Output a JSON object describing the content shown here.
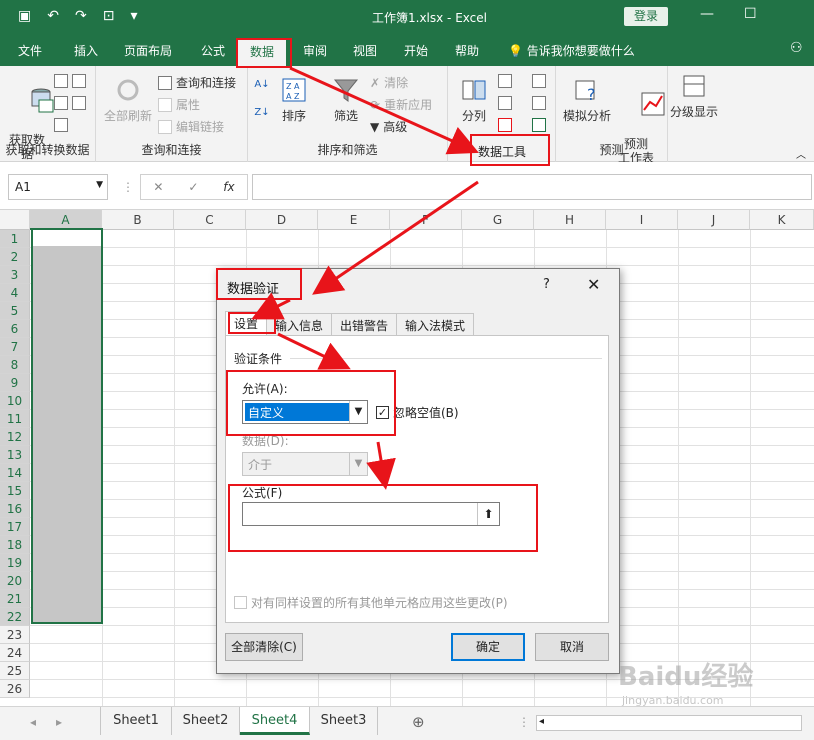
{
  "window": {
    "title": "工作簿1.xlsx  -  Excel",
    "login": "登录",
    "min": "—",
    "restore": "☐"
  },
  "menu": {
    "tabs": [
      "文件",
      "插入",
      "页面布局",
      "公式",
      "数据",
      "审阅",
      "视图",
      "开始",
      "帮助"
    ],
    "tellme": "告诉我你想要做什么"
  },
  "ribbon": {
    "get_data": "获取数\n据",
    "group1_label": "获取和转换数据",
    "refresh_all": "全部刷新",
    "queries": "查询和连接",
    "properties": "属性",
    "edit_links": "编辑链接",
    "group2_label": "查询和连接",
    "sort": "排序",
    "filter": "筛选",
    "clear": "清除",
    "reapply": "重新应用",
    "advanced": "高级",
    "group3_label": "排序和筛选",
    "text_to_columns": "分列",
    "group4_label": "数据工具",
    "what_if": "模拟分析",
    "forecast": "预测\n工作表",
    "group5_label": "预测",
    "outline": "分级显示"
  },
  "formula_bar": {
    "namebox": "A1",
    "fx": "fx"
  },
  "grid": {
    "columns": [
      "A",
      "B",
      "C",
      "D",
      "E",
      "F",
      "G",
      "H",
      "I",
      "J",
      "K"
    ],
    "rows": [
      "1",
      "2",
      "3",
      "4",
      "5",
      "6",
      "7",
      "8",
      "9",
      "10",
      "11",
      "12",
      "13",
      "14",
      "15",
      "16",
      "17",
      "18",
      "19",
      "20",
      "21",
      "22",
      "23",
      "24",
      "25",
      "26"
    ]
  },
  "sheets": [
    "Sheet1",
    "Sheet2",
    "Sheet4",
    "Sheet3"
  ],
  "active_sheet": "Sheet4",
  "dialog": {
    "title": "数据验证",
    "help": "?",
    "close": "✕",
    "tabs": [
      "设置",
      "输入信息",
      "出错警告",
      "输入法模式"
    ],
    "criteria_label": "验证条件",
    "allow_label": "允许(A):",
    "allow_value": "自定义",
    "ignore_blank": "忽略空值(B)",
    "data_label": "数据(D):",
    "data_value": "介于",
    "formula_label": "公式(F)",
    "apply_all": "对有同样设置的所有其他单元格应用这些更改(P)",
    "clear_all": "全部清除(C)",
    "ok": "确定",
    "cancel": "取消"
  },
  "watermark": {
    "brand": "Baidu经验",
    "url": "jingyan.baidu.com"
  },
  "colors": {
    "excel_green": "#217346",
    "highlight": "#e8141a",
    "selection": "#0078d7"
  }
}
